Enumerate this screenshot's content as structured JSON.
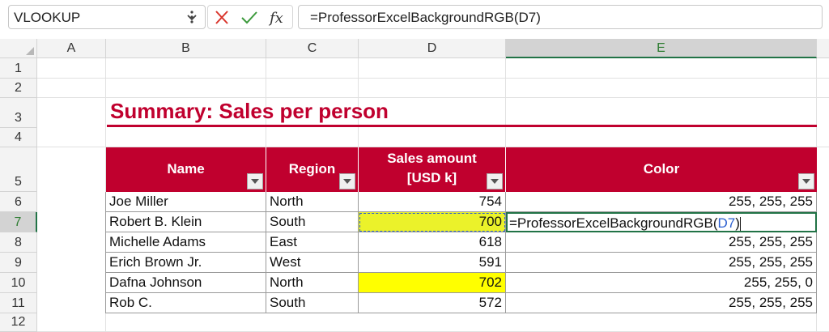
{
  "formula_bar": {
    "name_box": "VLOOKUP",
    "formula": "=ProfessorExcelBackgroundRGB(D7)"
  },
  "columns": [
    "A",
    "B",
    "C",
    "D",
    "E"
  ],
  "rows": [
    "1",
    "2",
    "3",
    "4",
    "5",
    "6",
    "7",
    "8",
    "9",
    "10",
    "11",
    "12"
  ],
  "title": "Summary: Sales per person",
  "table": {
    "headers": {
      "name": "Name",
      "region": "Region",
      "sales_line1": "Sales amount",
      "sales_line2": "[USD k]",
      "color": "Color"
    },
    "rows": [
      {
        "name": "Joe Miller",
        "region": "North",
        "sales": "754",
        "color": "255, 255, 255"
      },
      {
        "name": "Robert B. Klein",
        "region": "South",
        "sales": "700",
        "color": ""
      },
      {
        "name": "Michelle Adams",
        "region": "East",
        "sales": "618",
        "color": "255, 255, 255"
      },
      {
        "name": "Erich Brown Jr.",
        "region": "West",
        "sales": "591",
        "color": "255, 255, 255"
      },
      {
        "name": "Dafna Johnson",
        "region": "North",
        "sales": "702",
        "color": "255, 255, 0"
      },
      {
        "name": "Rob C.",
        "region": "South",
        "sales": "572",
        "color": "255, 255, 255"
      }
    ]
  },
  "edit_cell": {
    "prefix": "=ProfessorExcelBackgroundRGB(",
    "ref": "D7",
    "suffix": ")"
  },
  "colors": {
    "header_red": "#c0002e",
    "highlight_yellow": "#ffff00",
    "selection_green": "#217346",
    "ref_blue": "#2b5fd0"
  }
}
